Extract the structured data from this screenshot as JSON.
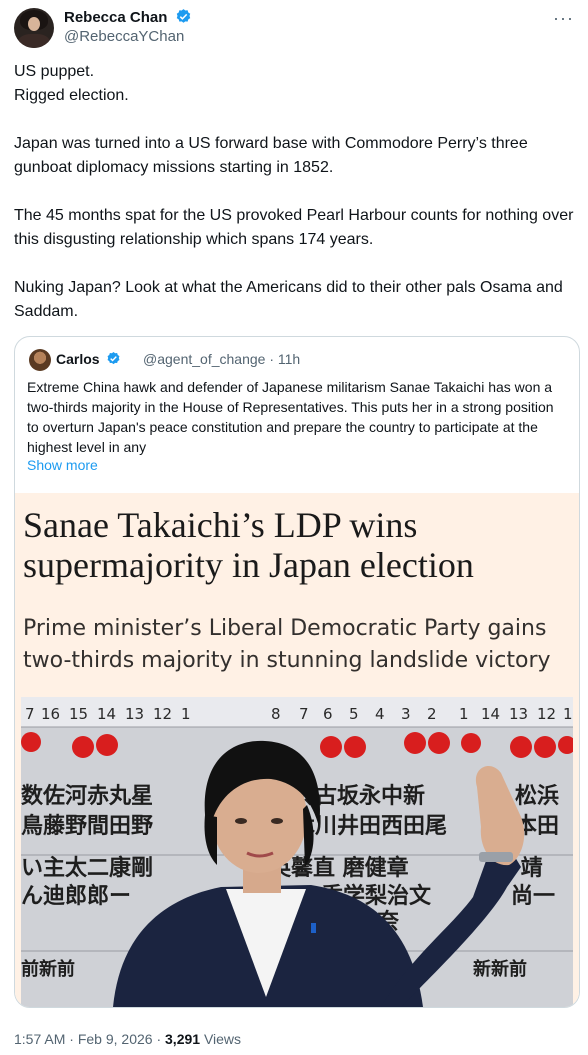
{
  "author": {
    "name": "Rebecca Chan",
    "handle": "@RebeccaYChan"
  },
  "tweet": {
    "paragraphs": [
      "US puppet.\nRigged election.",
      "Japan was turned into a US forward base with Commodore Perry’s three gunboat diplomacy missions starting in 1852.",
      "The 45 months spat for the US provoked Pearl Harbour counts for nothing over this disgusting relationship which spans 174 years.",
      "Nuking Japan? Look at what the Americans did to their other pals Osama and Saddam."
    ]
  },
  "quote": {
    "name": "Carlos",
    "handle": "@agent_of_change",
    "age": "· 11h",
    "text": "Extreme China hawk and defender of Japanese militarism Sanae Takaichi has won a two-thirds majority  in the House of Representatives. This puts her in a strong position to overturn Japan's peace constitution and prepare the country to participate at the highest level in any",
    "show_more": "Show more",
    "article": {
      "headline": "Sanae Takaichi’s LDP wins supermajority in Japan election",
      "subheadline": "Prime minister’s Liberal Democratic Party gains two-thirds majority in stunning landslide victory"
    },
    "board": {
      "numbers_left": [
        "7",
        "16",
        "15",
        "14",
        "13",
        "12",
        "1"
      ],
      "numbers_right": [
        "8",
        "7",
        "6",
        "5",
        "4",
        "3",
        "2",
        "1",
        "14",
        "13",
        "12",
        "1"
      ],
      "row1": "数佐河赤丸星",
      "row2": "鳥藤野間田野",
      "row3": "い主太二康剛",
      "row4": "ん迪郎郎ー",
      "row5": "前新前",
      "mid_row1": "鈴古坂永中新",
      "mid_row2": "木川井田西田尾",
      "mid_row3": "英馨直 磨健章",
      "mid_row4": "季学梨治文",
      "mid_row5": "奈",
      "right_row1": "松浜",
      "right_row2": "本田",
      "right_row3": "春 靖",
      "right_row4": "尚一",
      "right_row5": "新新前"
    }
  },
  "footer": {
    "time": "1:57 AM",
    "date": "Feb 9, 2026",
    "views_count": "3,291",
    "views_label": "Views"
  }
}
